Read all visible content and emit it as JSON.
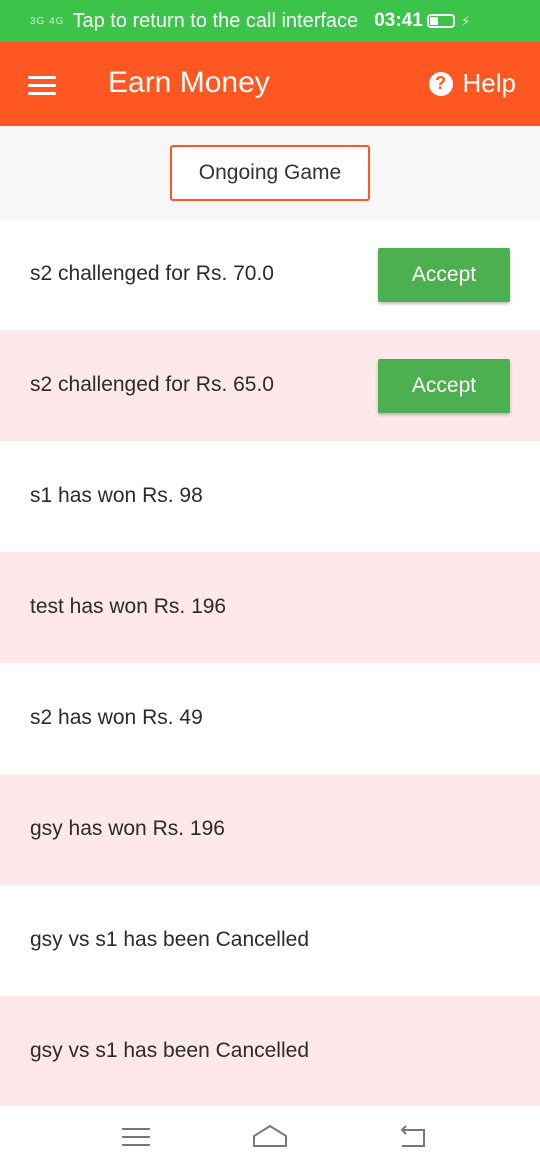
{
  "status_bar": {
    "signal": "3G 4G",
    "call_text": "Tap to return to the call interface",
    "time": "03:41"
  },
  "app_bar": {
    "title": "Earn Money",
    "help_label": "Help",
    "help_glyph": "?"
  },
  "tab": {
    "ongoing_label": "Ongoing Game"
  },
  "items": [
    {
      "text": "s2 challenged for Rs. 70.0",
      "action": "Accept"
    },
    {
      "text": "s2 challenged for Rs. 65.0",
      "action": "Accept"
    },
    {
      "text": "s1 has won Rs. 98"
    },
    {
      "text": "test has won Rs. 196"
    },
    {
      "text": "s2 has won Rs. 49"
    },
    {
      "text": "gsy has won Rs. 196"
    },
    {
      "text": "gsy vs s1 has been Cancelled"
    },
    {
      "text": "gsy vs s1 has been Cancelled"
    }
  ],
  "colors": {
    "status_green": "#3cc34a",
    "app_bar_orange": "#ff5722",
    "accept_green": "#4caf50",
    "row_pink": "#ffe8ea"
  }
}
